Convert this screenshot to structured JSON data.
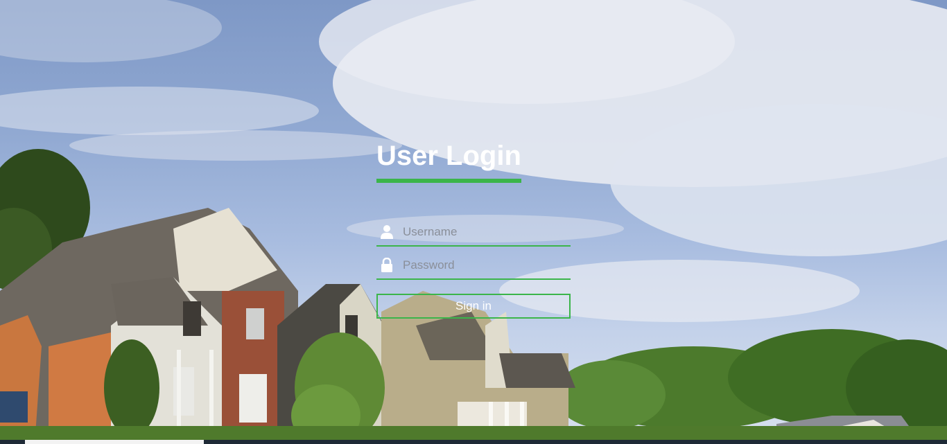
{
  "login": {
    "title": "User Login",
    "username_placeholder": "Username",
    "password_placeholder": "Password",
    "signin_label": "Sign in"
  },
  "colors": {
    "accent": "#3bb54a",
    "title_text": "#ffffff",
    "placeholder_text": "#8a8f99"
  },
  "icons": {
    "username": "user-icon",
    "password": "lock-icon"
  }
}
